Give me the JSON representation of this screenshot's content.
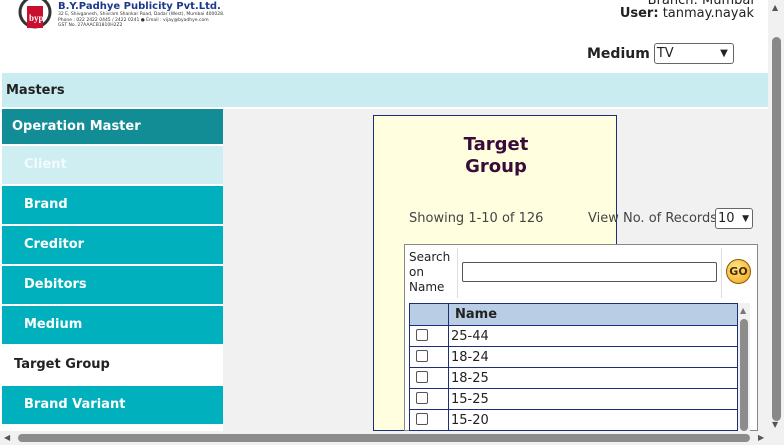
{
  "header": {
    "company_name": "B.Y.Padhye Publicity Pvt.Ltd.",
    "address_lines": [
      "32 E, Shivganesh, Shivram Shankar Road, Dadar (West), Mumbai 400028.",
      "Phone : 022 2422 0445 / 2422 0241  ●  Email : vijay@byadhye.com",
      "GST No. 27AAACB1810H2Z2"
    ],
    "branch": "Branch: Mumbai",
    "user_label": "User:",
    "user_name": "tanmay.nayak",
    "medium_label": "Medium",
    "medium_value": "TV"
  },
  "masters_bar": "Masters",
  "sidebar": {
    "header": "Operation Master",
    "items": [
      {
        "label": "Client"
      },
      {
        "label": "Brand"
      },
      {
        "label": "Creditor"
      },
      {
        "label": "Debitors"
      },
      {
        "label": "Medium"
      },
      {
        "label": "Target Group"
      },
      {
        "label": "Brand Variant"
      }
    ]
  },
  "panel": {
    "title_line1": "Target",
    "title_line2": "Group",
    "showing": "Showing 1-10 of 126",
    "view_records_label": "View No. of Records:",
    "records_value": "10",
    "search_label_line1": "Search",
    "search_label_line2": "on",
    "search_label_line3": "Name",
    "search_value": "",
    "go_label": "GO",
    "table": {
      "header": "Name",
      "rows": [
        "25-44",
        "18-24",
        "18-25",
        "15-25",
        "15-20"
      ]
    }
  },
  "icons": {
    "logo": "company-logo",
    "go": "go-button-icon",
    "select_chevron": "chevron-down-icon"
  },
  "colors": {
    "masters_bar": "#c9ecf0",
    "sidebar_header": "#128c95",
    "sidebar_item": "#00b0bc",
    "panel_bg": "#ffffe0",
    "table_header": "#b9cde4"
  }
}
